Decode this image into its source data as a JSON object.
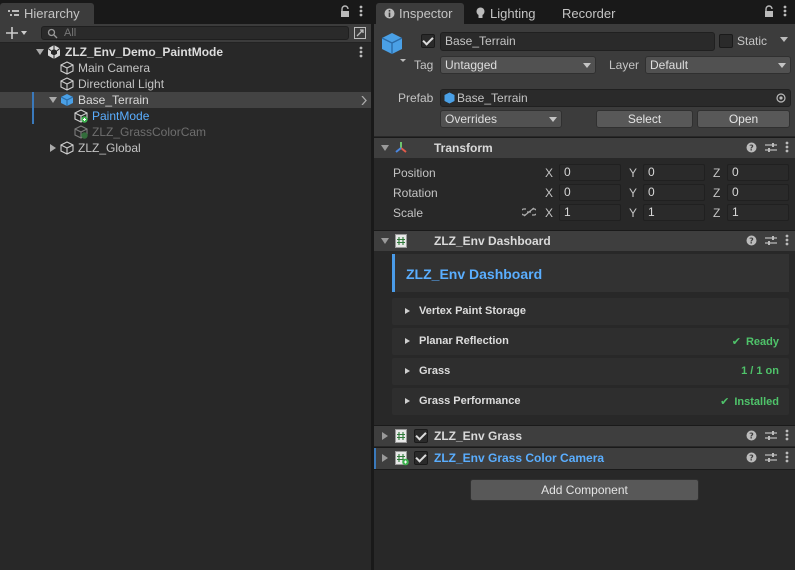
{
  "hierarchy": {
    "tab_label": "Hierarchy",
    "search_placeholder": "All",
    "scene_name": "ZLZ_Env_Demo_PaintMode",
    "items": [
      {
        "label": "Main Camera"
      },
      {
        "label": "Directional Light"
      },
      {
        "label": "Base_Terrain"
      },
      {
        "label": "PaintMode"
      },
      {
        "label": "ZLZ_GrassColorCam"
      },
      {
        "label": "ZLZ_Global"
      }
    ]
  },
  "inspector": {
    "tabs": [
      {
        "label": "Inspector"
      },
      {
        "label": "Lighting"
      },
      {
        "label": "Recorder"
      }
    ],
    "object_name": "Base_Terrain",
    "static_label": "Static",
    "tag_label": "Tag",
    "tag_value": "Untagged",
    "layer_label": "Layer",
    "layer_value": "Default",
    "prefab_label": "Prefab",
    "prefab_value": "Base_Terrain",
    "overrides_label": "Overrides",
    "select_label": "Select",
    "open_label": "Open",
    "transform": {
      "title": "Transform",
      "position_label": "Position",
      "rotation_label": "Rotation",
      "scale_label": "Scale",
      "x": "X",
      "y": "Y",
      "z": "Z",
      "position": [
        "0",
        "0",
        "0"
      ],
      "rotation": [
        "0",
        "0",
        "0"
      ],
      "scale": [
        "1",
        "1",
        "1"
      ]
    },
    "dashboard": {
      "title": "ZLZ_Env Dashboard",
      "heading": "ZLZ_Env Dashboard",
      "sections": [
        {
          "label": "Vertex Paint Storage",
          "status": ""
        },
        {
          "label": "Planar Reflection",
          "status": "Ready"
        },
        {
          "label": "Grass",
          "status": "1 / 1 on"
        },
        {
          "label": "Grass Performance",
          "status": "Installed"
        }
      ]
    },
    "grass_title": "ZLZ_Env Grass",
    "grass_cam_title": "ZLZ_Env Grass Color Camera",
    "add_component_label": "Add Component"
  },
  "colors": {
    "accent_blue": "#5aaeff",
    "status_green": "#4fc36a",
    "selection": "#434343"
  }
}
